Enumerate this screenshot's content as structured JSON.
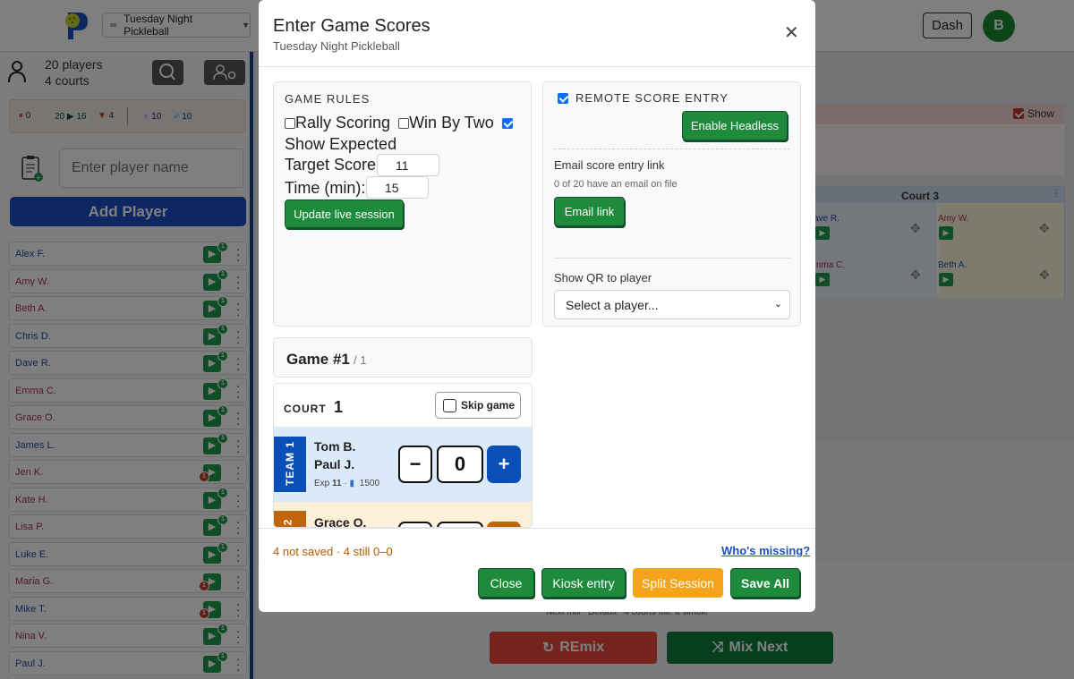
{
  "app": {
    "session_name": "Tuesday Night Pickleball",
    "dash_label": "Dash",
    "avatar_letter": "B"
  },
  "sidebar": {
    "players_count": "20 players",
    "courts_count": "4 courts",
    "stats": {
      "paused": "0",
      "flow": "20 ▶ 16",
      "down": "4",
      "female": "10",
      "male": "10"
    },
    "player_input_placeholder": "Enter player name",
    "add_player_label": "Add Player",
    "players": [
      {
        "name": "Alex F.",
        "badge": "1"
      },
      {
        "name": "Amy W.",
        "badge": "1"
      },
      {
        "name": "Beth A.",
        "badge": "1"
      },
      {
        "name": "Chris D.",
        "badge": "1"
      },
      {
        "name": "Dave R.",
        "badge": "1"
      },
      {
        "name": "Emma C.",
        "badge": "1"
      },
      {
        "name": "Grace O.",
        "badge": "1"
      },
      {
        "name": "James L.",
        "badge": "1"
      },
      {
        "name": "Jen K.",
        "badge": "1"
      },
      {
        "name": "Kate H.",
        "badge": "1"
      },
      {
        "name": "Lisa P.",
        "badge": "1"
      },
      {
        "name": "Luke E.",
        "badge": "1"
      },
      {
        "name": "Maria G.",
        "badge": "1"
      },
      {
        "name": "Mike T.",
        "badge": "1"
      },
      {
        "name": "Nina V.",
        "badge": "1"
      },
      {
        "name": "Paul J.",
        "badge": "1"
      }
    ]
  },
  "main": {
    "show_label": "Show",
    "court3_title": "Court 3",
    "court3_players": [
      "ave R.",
      "Amy W.",
      "mma C.",
      "Beth A."
    ],
    "court_badge": "1",
    "footer_fragment": "Next mix   Default   4 courts full, a simple",
    "remix_label": "REmix",
    "mix_next_label": "Mix Next"
  },
  "modal": {
    "title": "Enter Game Scores",
    "subtitle": "Tuesday Night Pickleball",
    "rules": {
      "heading": "GAME RULES",
      "rally_scoring": "Rally Scoring",
      "win_by_two": "Win By Two",
      "show_expected": "Show Expected",
      "target_label": "Target Score:",
      "target_value": "11",
      "time_label": "Time (min):",
      "time_value": "15",
      "update_button": "Update live session"
    },
    "remote": {
      "heading": "REMOTE SCORE ENTRY",
      "enable_headless": "Enable Headless",
      "email_heading": "Email score entry link",
      "email_status": "0 of 20 have an email on file",
      "email_button": "Email link",
      "qr_label": "Show QR to player",
      "qr_select": "Select a player..."
    },
    "game": {
      "title": "Game #1",
      "of_total": "/ 1",
      "court_label": "COURT",
      "court_number": "1",
      "skip_label": "Skip game",
      "team1_label": "TEAM 1",
      "team1_players": [
        "Tom B.",
        "Paul J."
      ],
      "team1_exp_label": "Exp",
      "team1_exp_value": "11",
      "team1_rating": "1500",
      "team1_score": "0",
      "team2_label": "2",
      "team2_first_player": "Grace O."
    },
    "footer": {
      "status": "4 not saved · 4 still 0–0",
      "whos_missing": "Who's missing?",
      "close": "Close",
      "kiosk": "Kiosk entry",
      "split": "Split Session",
      "save_all": "Save All"
    }
  },
  "colors": {
    "primary_green": "#1e8a3c",
    "blue": "#1c4fc4",
    "orange": "#f5a31a",
    "team1": "#0a4fb8",
    "team2": "#c0650a"
  }
}
